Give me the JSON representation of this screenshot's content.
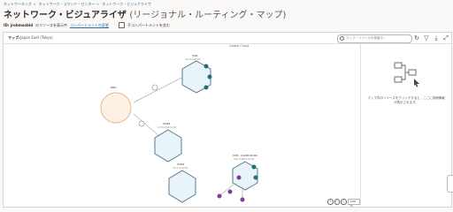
{
  "breadcrumbs": [
    "ネットワーキング",
    "ネットワーク・コマンド・センター",
    "ネットワーク・ビジュアライザ"
  ],
  "page": {
    "title": "ネットワーク・ビジュアライザ",
    "subtitle": "(リージョナル・ルーティング・マップ)"
  },
  "subbar": {
    "compartment_label": "ID: jrobmsobld",
    "compartment_suffix": "のリソースを表示中",
    "change_link": "コンパートメントの変更",
    "include_children": "子コンパートメントを含む"
  },
  "map": {
    "label": "マップ:",
    "region": "Japan East (Tokyo)",
    "search_placeholder": "マップ・リソースを検索中...",
    "region_caption": "Global Cloud",
    "zoom_percent": "100 %"
  },
  "info_panel": {
    "text": "マップ内のリソースをクリックすると、ここに詳細情報が表示されます。"
  },
  "nodes": {
    "drg": "DRG",
    "vcn1": "VCN",
    "vcn1_sub": "10.0.0.0/16",
    "vcn2": "VCN2",
    "vcn2_sub": "172.16.0.0/16",
    "vcn3": "VCN3",
    "vcn3_sub": "10.1.0.0/16",
    "vcn4": "VCN - 01/08 00:00",
    "vcn4_sub": "192.168.0.0/16"
  },
  "colors": {
    "accent": "#2a6f97",
    "vcn_fill": "#e8f3fa",
    "vcn_stroke": "#5a7a8f",
    "drg_fill": "#fdf1e6",
    "drg_stroke": "#e8b98c",
    "badge_teal": "#1f6f78",
    "badge_purple": "#7b3f8f"
  },
  "icons": {
    "search": "search-icon",
    "refresh": "refresh-icon",
    "filter": "filter-icon",
    "download": "download-icon",
    "fullscreen": "fullscreen-icon",
    "empty_state": "topology-icon"
  }
}
